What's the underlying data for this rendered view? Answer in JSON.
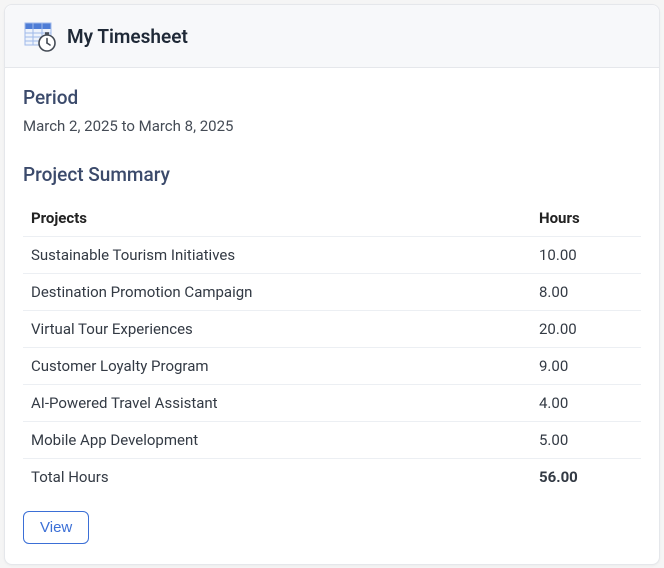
{
  "header": {
    "title": "My Timesheet"
  },
  "period": {
    "label": "Period",
    "value": "March 2, 2025 to March 8, 2025"
  },
  "summary": {
    "title": "Project Summary",
    "columns": {
      "projects": "Projects",
      "hours": "Hours"
    },
    "rows": [
      {
        "project": "Sustainable Tourism Initiatives",
        "hours": "10.00"
      },
      {
        "project": "Destination Promotion Campaign",
        "hours": "8.00"
      },
      {
        "project": "Virtual Tour Experiences",
        "hours": "20.00"
      },
      {
        "project": "Customer Loyalty Program",
        "hours": "9.00"
      },
      {
        "project": "AI-Powered Travel Assistant",
        "hours": "4.00"
      },
      {
        "project": "Mobile App Development",
        "hours": "5.00"
      }
    ],
    "total": {
      "label": "Total Hours",
      "hours": "56.00"
    }
  },
  "actions": {
    "view": "View"
  },
  "icons": {
    "timesheet": "timesheet-stopwatch-icon"
  },
  "colors": {
    "accent": "#3b6fd6",
    "icon_blue": "#4f7dd6",
    "icon_blue_light": "#9fb9ea"
  }
}
